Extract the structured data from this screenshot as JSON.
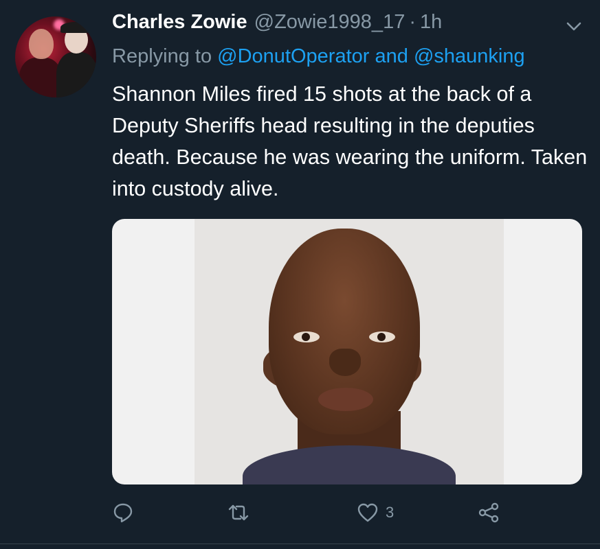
{
  "tweet": {
    "author_name": "Charles Zowie",
    "author_handle": "@Zowie1998_17",
    "separator": "·",
    "time": "1h",
    "reply_prefix": "Replying to",
    "reply_mention_1": "@DonutOperator",
    "reply_and": "and",
    "reply_mention_2": "@shaunking",
    "text": "Shannon Miles fired 15 shots at the back of a Deputy Sheriffs head resulting in the deputies death. Because he was wearing the uniform. Taken into custody alive.",
    "like_count": "3"
  },
  "icons": {
    "more": "chevron-down-icon",
    "reply": "reply-icon",
    "retweet": "retweet-icon",
    "like": "heart-icon",
    "share": "share-icon"
  },
  "colors": {
    "background": "#15202b",
    "accent": "#1da1f2",
    "secondary_text": "#8899a6",
    "primary_text": "#ffffff"
  }
}
